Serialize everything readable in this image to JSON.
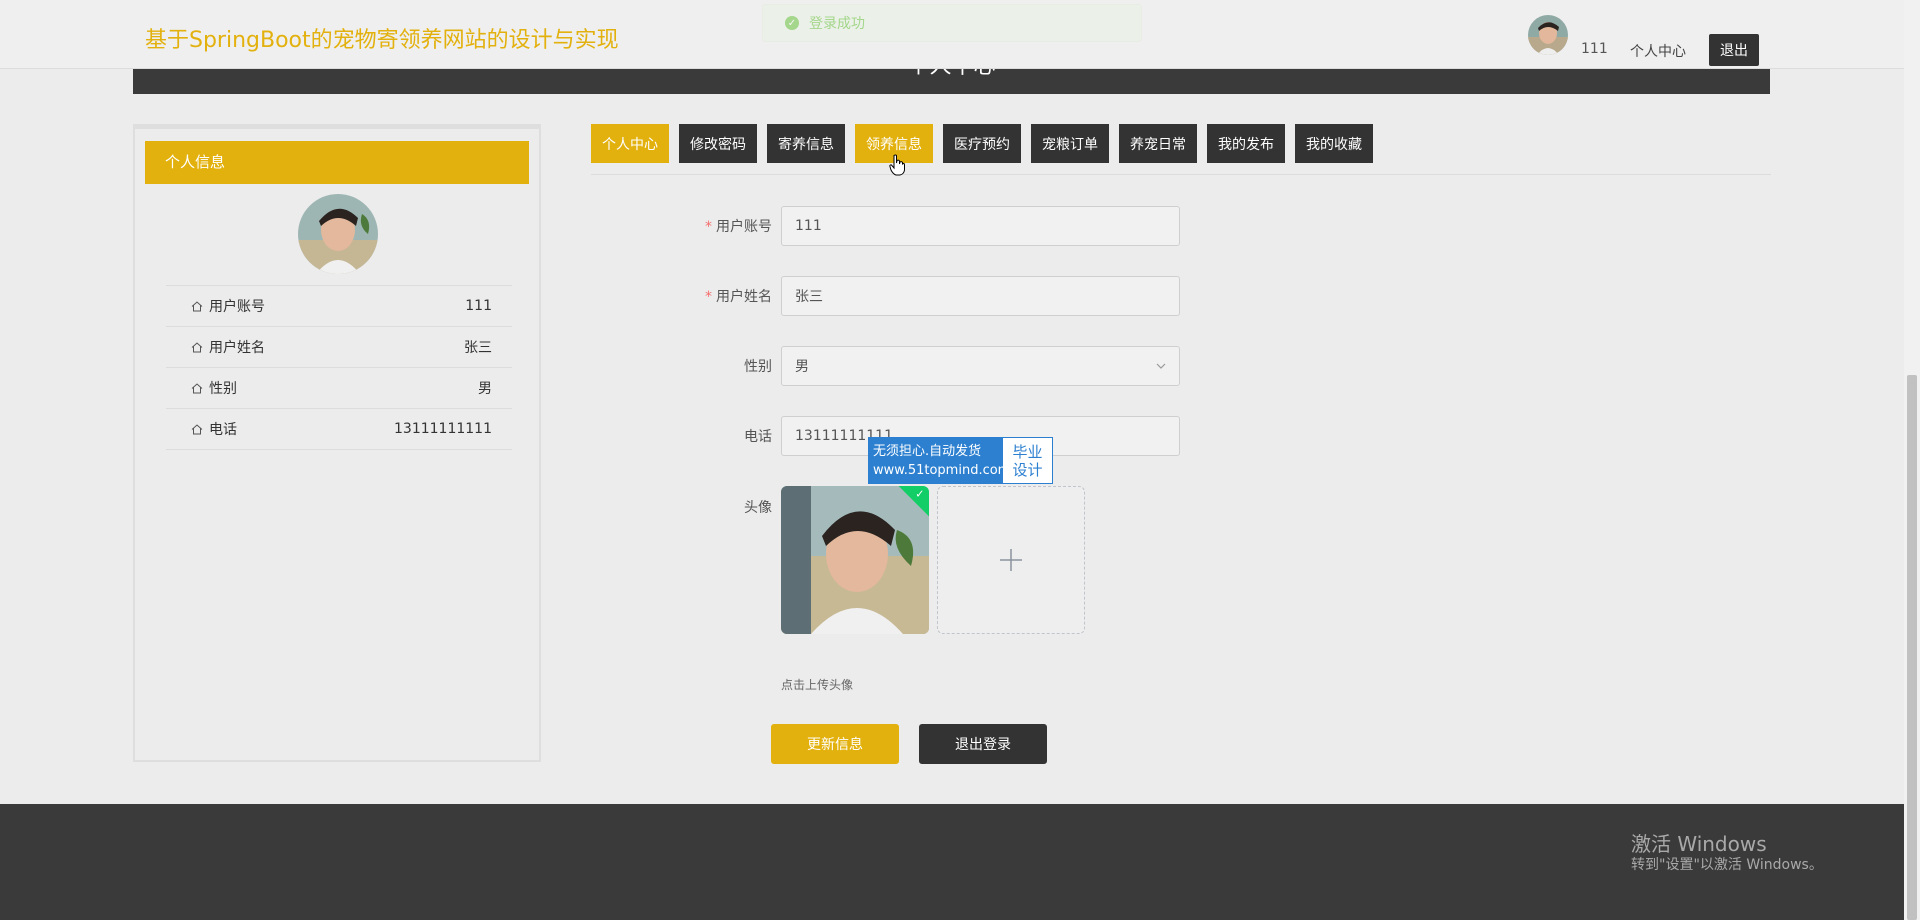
{
  "header": {
    "site_title": "基于SpringBoot的宠物寄领养网站的设计与实现",
    "username": "111",
    "center_link": "个人中心",
    "logout_button": "退出"
  },
  "toast": {
    "message": "登录成功"
  },
  "banner": {
    "title": "个人中心"
  },
  "sidebar": {
    "heading": "个人信息",
    "items": [
      {
        "label": "用户账号",
        "value": "111"
      },
      {
        "label": "用户姓名",
        "value": "张三"
      },
      {
        "label": "性别",
        "value": "男"
      },
      {
        "label": "电话",
        "value": "13111111111"
      }
    ]
  },
  "tabs": [
    {
      "label": "个人中心",
      "state": "active"
    },
    {
      "label": "修改密码"
    },
    {
      "label": "寄养信息"
    },
    {
      "label": "领养信息",
      "state": "hover"
    },
    {
      "label": "医疗预约"
    },
    {
      "label": "宠粮订单"
    },
    {
      "label": "养宠日常"
    },
    {
      "label": "我的发布"
    },
    {
      "label": "我的收藏"
    }
  ],
  "form": {
    "account": {
      "label": "用户账号",
      "value": "111",
      "required": true
    },
    "name": {
      "label": "用户姓名",
      "value": "张三",
      "required": true
    },
    "gender": {
      "label": "性别",
      "value": "男"
    },
    "phone": {
      "label": "电话",
      "value": "13111111111"
    },
    "avatar": {
      "label": "头像",
      "tip": "点击上传头像",
      "add_icon": "plus-icon"
    },
    "update_button": "更新信息",
    "logout_button": "退出登录"
  },
  "watermark": {
    "line1": "无须担心.自动发货",
    "line2": "www.51topmind.com",
    "right1": "毕业",
    "right2": "设计"
  },
  "os_watermark": {
    "title": "激活 Windows",
    "subtitle": "转到\"设置\"以激活 Windows。"
  },
  "colors": {
    "accent": "#e3b10e",
    "dark": "#333333",
    "required": "#f56c6c",
    "success": "#13ce66"
  }
}
